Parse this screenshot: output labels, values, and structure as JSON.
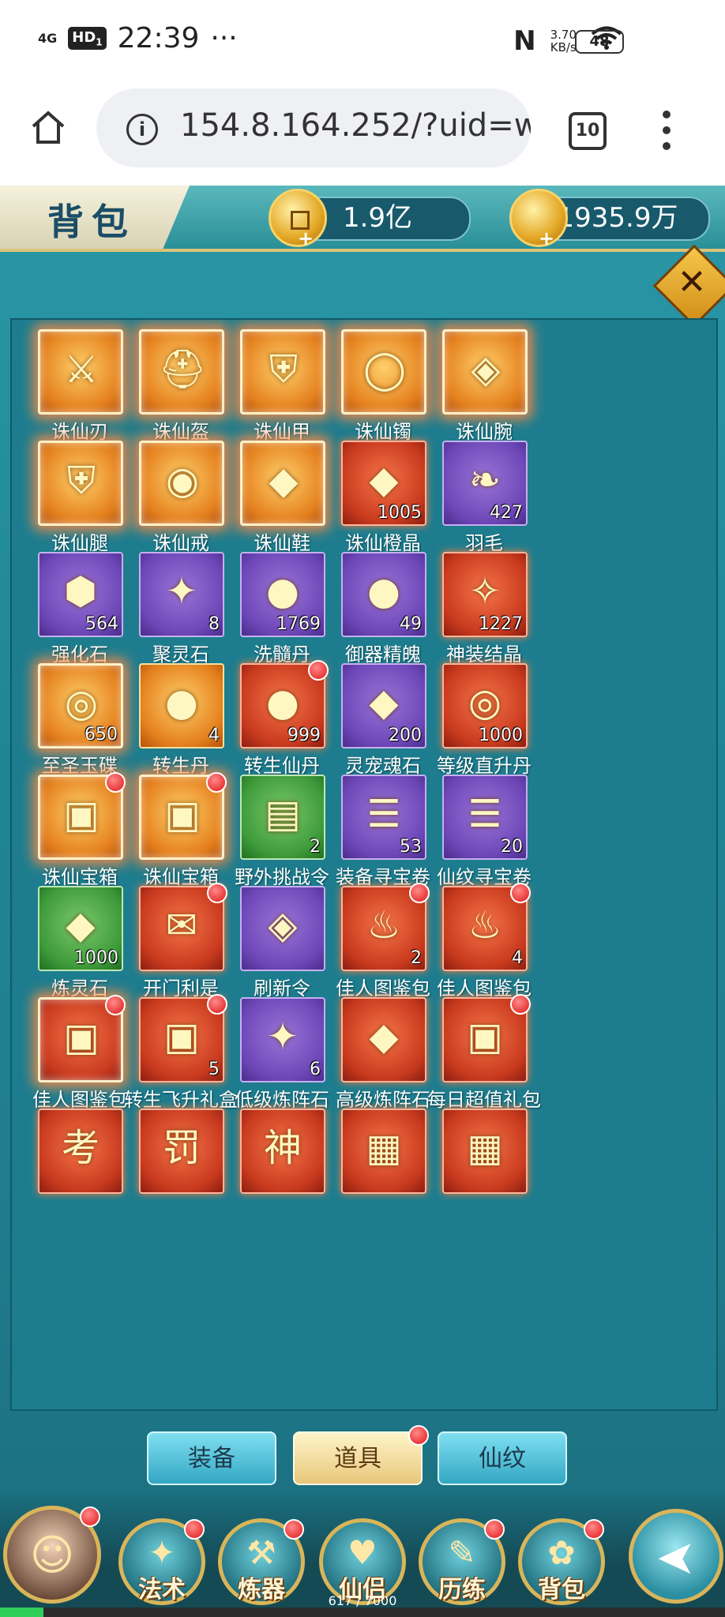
{
  "status_bar": {
    "network": "4G",
    "hd": "HD",
    "hd_sub": "1",
    "time": "22:39",
    "more": "···",
    "nfc": "N",
    "speed_value": "3.70",
    "speed_unit": "KB/s",
    "battery": "48"
  },
  "browser": {
    "url": "154.8.164.252/?uid=w",
    "tab_count": "10"
  },
  "game": {
    "title": "背包",
    "currency": [
      {
        "value": "1.9亿",
        "icon": "coin-icon"
      },
      {
        "value": "1935.9万",
        "icon": "ingot-icon"
      }
    ],
    "tabs": [
      {
        "label": "装备",
        "active": false,
        "dot": false
      },
      {
        "label": "道具",
        "active": true,
        "dot": true
      },
      {
        "label": "仙纹",
        "active": false,
        "dot": false
      }
    ],
    "nav": [
      {
        "label": "",
        "icon": "avatar-icon",
        "dot": true
      },
      {
        "label": "法术",
        "icon": "spell-icon",
        "dot": true
      },
      {
        "label": "炼器",
        "icon": "forge-icon",
        "dot": true
      },
      {
        "label": "仙侣",
        "icon": "companion-icon",
        "dot": false
      },
      {
        "label": "历练",
        "icon": "training-icon",
        "dot": true
      },
      {
        "label": "背包",
        "icon": "bag-icon",
        "dot": true
      },
      {
        "label": "",
        "icon": "back-arrow-icon",
        "dot": false
      }
    ],
    "exp_text": "617 / 7000",
    "exp_fraction": 0.06
  },
  "items": [
    {
      "name": "诛仙刃",
      "count": "",
      "quality": "orange",
      "legend": true,
      "dot": false,
      "glyph": "⚔"
    },
    {
      "name": "诛仙盔",
      "count": "",
      "quality": "orange",
      "legend": true,
      "dot": false,
      "glyph": "⛑"
    },
    {
      "name": "诛仙甲",
      "count": "",
      "quality": "orange",
      "legend": true,
      "dot": false,
      "glyph": "⛨"
    },
    {
      "name": "诛仙镯",
      "count": "",
      "quality": "orange",
      "legend": true,
      "dot": false,
      "glyph": "◯"
    },
    {
      "name": "诛仙腕",
      "count": "",
      "quality": "orange",
      "legend": true,
      "dot": false,
      "glyph": "◈"
    },
    {
      "name": "诛仙腿",
      "count": "",
      "quality": "orange",
      "legend": true,
      "dot": false,
      "glyph": "⛨"
    },
    {
      "name": "诛仙戒",
      "count": "",
      "quality": "orange",
      "legend": true,
      "dot": false,
      "glyph": "◉"
    },
    {
      "name": "诛仙鞋",
      "count": "",
      "quality": "orange",
      "legend": true,
      "dot": false,
      "glyph": "◆"
    },
    {
      "name": "诛仙橙晶",
      "count": "1005",
      "quality": "red",
      "legend": false,
      "dot": false,
      "glyph": "◆"
    },
    {
      "name": "羽毛",
      "count": "427",
      "quality": "purple",
      "legend": false,
      "dot": false,
      "glyph": "❧"
    },
    {
      "name": "强化石",
      "count": "564",
      "quality": "purple",
      "legend": false,
      "dot": false,
      "glyph": "⬢"
    },
    {
      "name": "聚灵石",
      "count": "8",
      "quality": "purple",
      "legend": false,
      "dot": false,
      "glyph": "✦"
    },
    {
      "name": "洗髓丹",
      "count": "1769",
      "quality": "purple",
      "legend": false,
      "dot": false,
      "glyph": "●"
    },
    {
      "name": "御器精魄",
      "count": "49",
      "quality": "purple",
      "legend": false,
      "dot": false,
      "glyph": "●"
    },
    {
      "name": "神装结晶",
      "count": "1227",
      "quality": "red",
      "legend": false,
      "dot": false,
      "glyph": "✧"
    },
    {
      "name": "至圣玉碟",
      "count": "650",
      "quality": "orange",
      "legend": true,
      "dot": false,
      "glyph": "◎"
    },
    {
      "name": "转生丹",
      "count": "4",
      "quality": "orange",
      "legend": false,
      "dot": false,
      "glyph": "●"
    },
    {
      "name": "转生仙丹",
      "count": "999",
      "quality": "red",
      "legend": false,
      "dot": true,
      "glyph": "●"
    },
    {
      "name": "灵宠魂石",
      "count": "200",
      "quality": "purple",
      "legend": false,
      "dot": false,
      "glyph": "◆"
    },
    {
      "name": "等级直升丹",
      "count": "1000",
      "quality": "red",
      "legend": false,
      "dot": false,
      "glyph": "◎"
    },
    {
      "name": "诛仙宝箱",
      "count": "",
      "quality": "orange",
      "legend": true,
      "dot": true,
      "glyph": "▣"
    },
    {
      "name": "诛仙宝箱",
      "count": "",
      "quality": "orange",
      "legend": true,
      "dot": true,
      "glyph": "▣"
    },
    {
      "name": "野外挑战令",
      "count": "2",
      "quality": "green",
      "legend": false,
      "dot": false,
      "glyph": "▤"
    },
    {
      "name": "装备寻宝卷",
      "count": "53",
      "quality": "purple",
      "legend": false,
      "dot": false,
      "glyph": "☰"
    },
    {
      "name": "仙纹寻宝卷",
      "count": "20",
      "quality": "purple",
      "legend": false,
      "dot": false,
      "glyph": "☰"
    },
    {
      "name": "炼灵石",
      "count": "1000",
      "quality": "green",
      "legend": false,
      "dot": false,
      "glyph": "◆"
    },
    {
      "name": "开门利是",
      "count": "",
      "quality": "red",
      "legend": false,
      "dot": true,
      "glyph": "✉"
    },
    {
      "name": "刷新令",
      "count": "",
      "quality": "purple",
      "legend": false,
      "dot": false,
      "glyph": "◈"
    },
    {
      "name": "佳人图鉴包",
      "count": "2",
      "quality": "red",
      "legend": false,
      "dot": true,
      "glyph": "♨"
    },
    {
      "name": "佳人图鉴包",
      "count": "4",
      "quality": "red",
      "legend": false,
      "dot": true,
      "glyph": "♨"
    },
    {
      "name": "佳人图鉴包",
      "count": "",
      "quality": "red",
      "legend": true,
      "dot": true,
      "glyph": "▣"
    },
    {
      "name": "转生飞升礼盒",
      "count": "5",
      "quality": "red",
      "legend": false,
      "dot": true,
      "glyph": "▣"
    },
    {
      "name": "低级炼阵石",
      "count": "6",
      "quality": "purple",
      "legend": false,
      "dot": false,
      "glyph": "✦"
    },
    {
      "name": "高级炼阵石",
      "count": "",
      "quality": "red",
      "legend": false,
      "dot": false,
      "glyph": "◆"
    },
    {
      "name": "每日超值礼包",
      "count": "",
      "quality": "red",
      "legend": false,
      "dot": true,
      "glyph": "▣"
    },
    {
      "name": "",
      "count": "",
      "quality": "red",
      "legend": false,
      "dot": false,
      "glyph": "考"
    },
    {
      "name": "",
      "count": "",
      "quality": "red",
      "legend": false,
      "dot": false,
      "glyph": "罚"
    },
    {
      "name": "",
      "count": "",
      "quality": "red",
      "legend": false,
      "dot": false,
      "glyph": "神"
    },
    {
      "name": "",
      "count": "",
      "quality": "red",
      "legend": false,
      "dot": false,
      "glyph": "▦"
    },
    {
      "name": "",
      "count": "",
      "quality": "red",
      "legend": false,
      "dot": false,
      "glyph": "▦"
    }
  ]
}
